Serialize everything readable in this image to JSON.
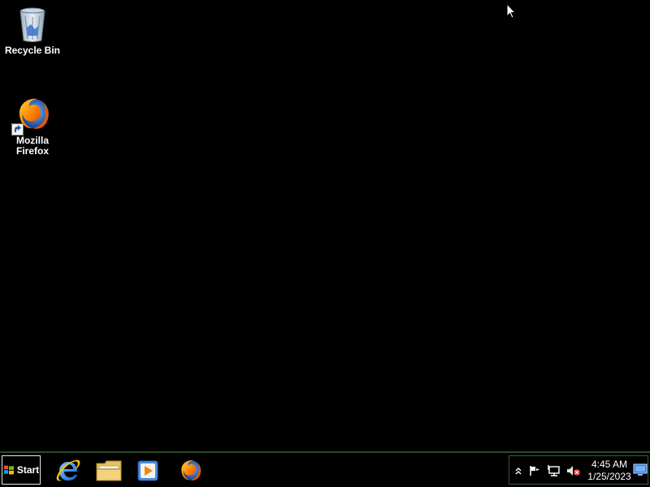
{
  "desktop": {
    "icons": [
      {
        "label": "Recycle Bin",
        "icon": "recycle-bin-icon"
      },
      {
        "label": "Mozilla\nFirefox",
        "icon": "firefox-icon",
        "shortcut": true
      }
    ],
    "background_color": "#000000"
  },
  "taskbar": {
    "start_label": "Start",
    "pinned_apps": [
      {
        "name": "Internet Explorer",
        "icon": "internet-explorer-icon"
      },
      {
        "name": "File Explorer",
        "icon": "file-explorer-icon"
      },
      {
        "name": "Windows Media Player",
        "icon": "media-player-icon"
      },
      {
        "name": "Mozilla Firefox",
        "icon": "firefox-icon"
      }
    ],
    "tray": {
      "icons": [
        "show-hidden-icons-icon",
        "action-center-flag-icon",
        "network-icon",
        "volume-muted-icon"
      ],
      "time": "4:45 AM",
      "date": "1/25/2023"
    }
  }
}
